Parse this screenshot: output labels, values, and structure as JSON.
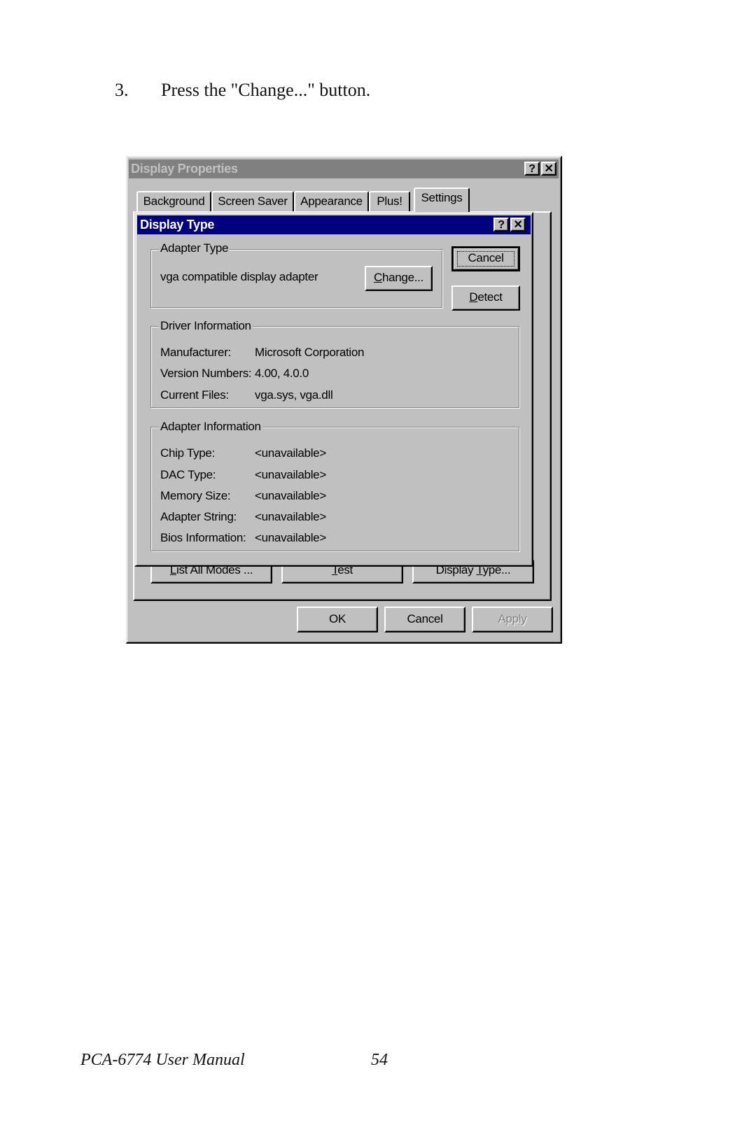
{
  "instruction": {
    "step_number": "3.",
    "text": "Press the \"Change...\" button."
  },
  "display_properties": {
    "title": "Display Properties",
    "help_button": "?",
    "close_button": "✕",
    "tabs": [
      {
        "label": "Background",
        "active": false
      },
      {
        "label": "Screen Saver",
        "active": false
      },
      {
        "label": "Appearance",
        "active": false
      },
      {
        "label": "Plus!",
        "active": false
      },
      {
        "label": "Settings",
        "active": true
      }
    ],
    "settings_buttons": {
      "list_all_modes": {
        "pre": "",
        "key": "L",
        "post": "ist All Modes ..."
      },
      "test": {
        "pre": "",
        "key": "T",
        "post": "est"
      },
      "display_type": {
        "pre": "Display ",
        "key": "T",
        "post": "ype..."
      }
    },
    "ok_label": "OK",
    "cancel_label": "Cancel",
    "apply_label": "Apply"
  },
  "display_type": {
    "title": "Display Type",
    "help_button": "?",
    "close_button": "✕",
    "cancel_label": "Cancel",
    "detect": {
      "key": "D",
      "post": "etect"
    },
    "adapter_type": {
      "group_label": "Adapter Type",
      "value": "vga compatible display adapter",
      "change": {
        "key": "C",
        "post": "hange..."
      }
    },
    "driver_information": {
      "group_label": "Driver Information",
      "rows": [
        {
          "label": "Manufacturer:",
          "value": "Microsoft Corporation"
        },
        {
          "label": "Version Numbers:",
          "value": "4.00, 4.0.0"
        },
        {
          "label": "Current Files:",
          "value": "vga.sys, vga.dll"
        }
      ]
    },
    "adapter_information": {
      "group_label": "Adapter Information",
      "rows": [
        {
          "label": "Chip Type:",
          "value": "<unavailable>"
        },
        {
          "label": "DAC Type:",
          "value": "<unavailable>"
        },
        {
          "label": "Memory Size:",
          "value": "<unavailable>"
        },
        {
          "label": "Adapter String:",
          "value": "<unavailable>"
        },
        {
          "label": "Bios Information:",
          "value": "<unavailable>"
        }
      ]
    }
  },
  "footer": {
    "manual_title": "PCA-6774 User Manual",
    "page_number": "54"
  }
}
